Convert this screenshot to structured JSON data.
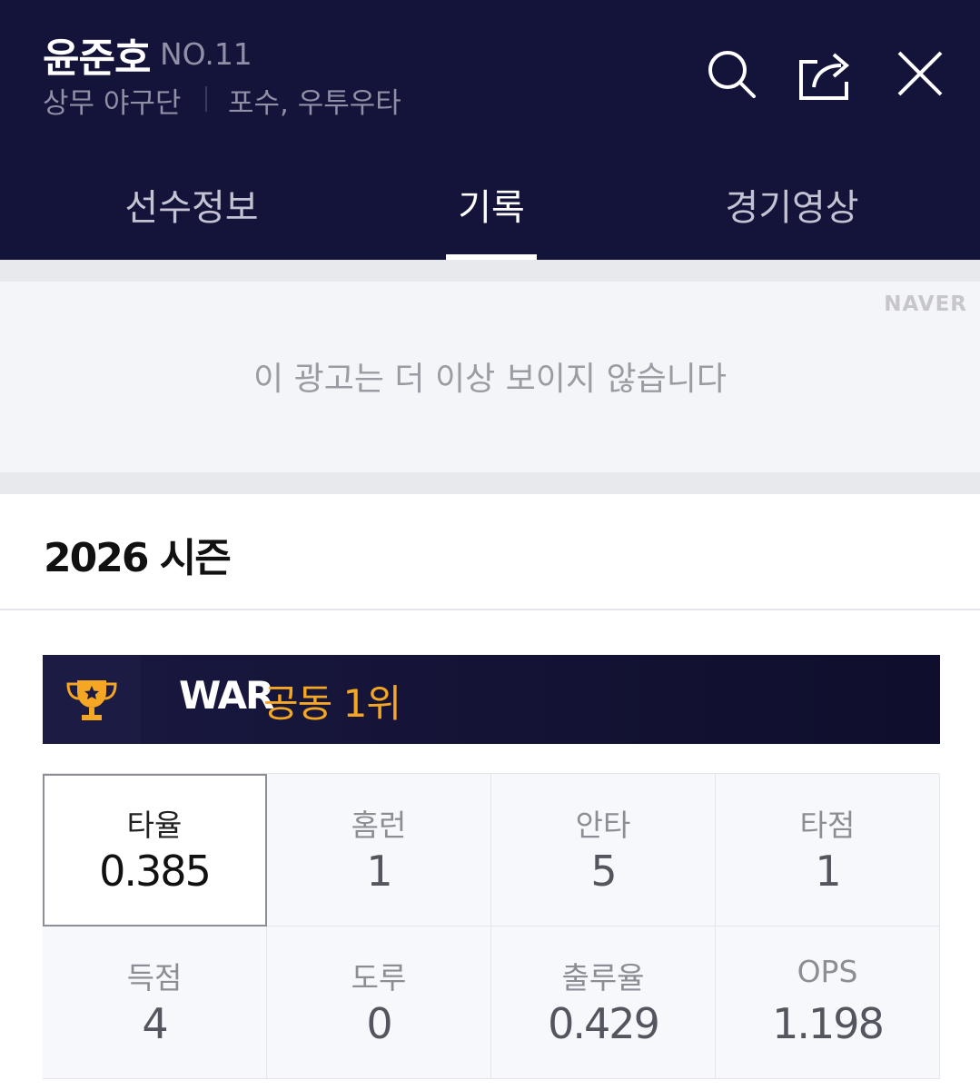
{
  "player": {
    "name": "윤준호",
    "number": "NO.11",
    "team": "상무 야구단",
    "position": "포수, 우투우타"
  },
  "header_icons": [
    "search-icon",
    "share-icon",
    "close-icon"
  ],
  "tabs": [
    {
      "label": "선수정보",
      "active": false
    },
    {
      "label": "기록",
      "active": true
    },
    {
      "label": "경기영상",
      "active": false
    }
  ],
  "ad": {
    "brand": "NAVER",
    "message": "이 광고는 더 이상 보이지 않습니다"
  },
  "season": {
    "title": "2026 시즌"
  },
  "war_banner": {
    "icon": "trophy-icon",
    "label": "WAR",
    "rank": "공동 1위"
  },
  "stats": [
    {
      "label": "타율",
      "value": "0.385",
      "selected": true
    },
    {
      "label": "홈런",
      "value": "1"
    },
    {
      "label": "안타",
      "value": "5"
    },
    {
      "label": "타점",
      "value": "1"
    },
    {
      "label": "득점",
      "value": "4"
    },
    {
      "label": "도루",
      "value": "0"
    },
    {
      "label": "출루율",
      "value": "0.429"
    },
    {
      "label": "OPS",
      "value": "1.198"
    }
  ],
  "colors": {
    "header_bg": "#14133a",
    "accent_orange": "#f5a623",
    "ad_bg": "#f4f5f9"
  }
}
